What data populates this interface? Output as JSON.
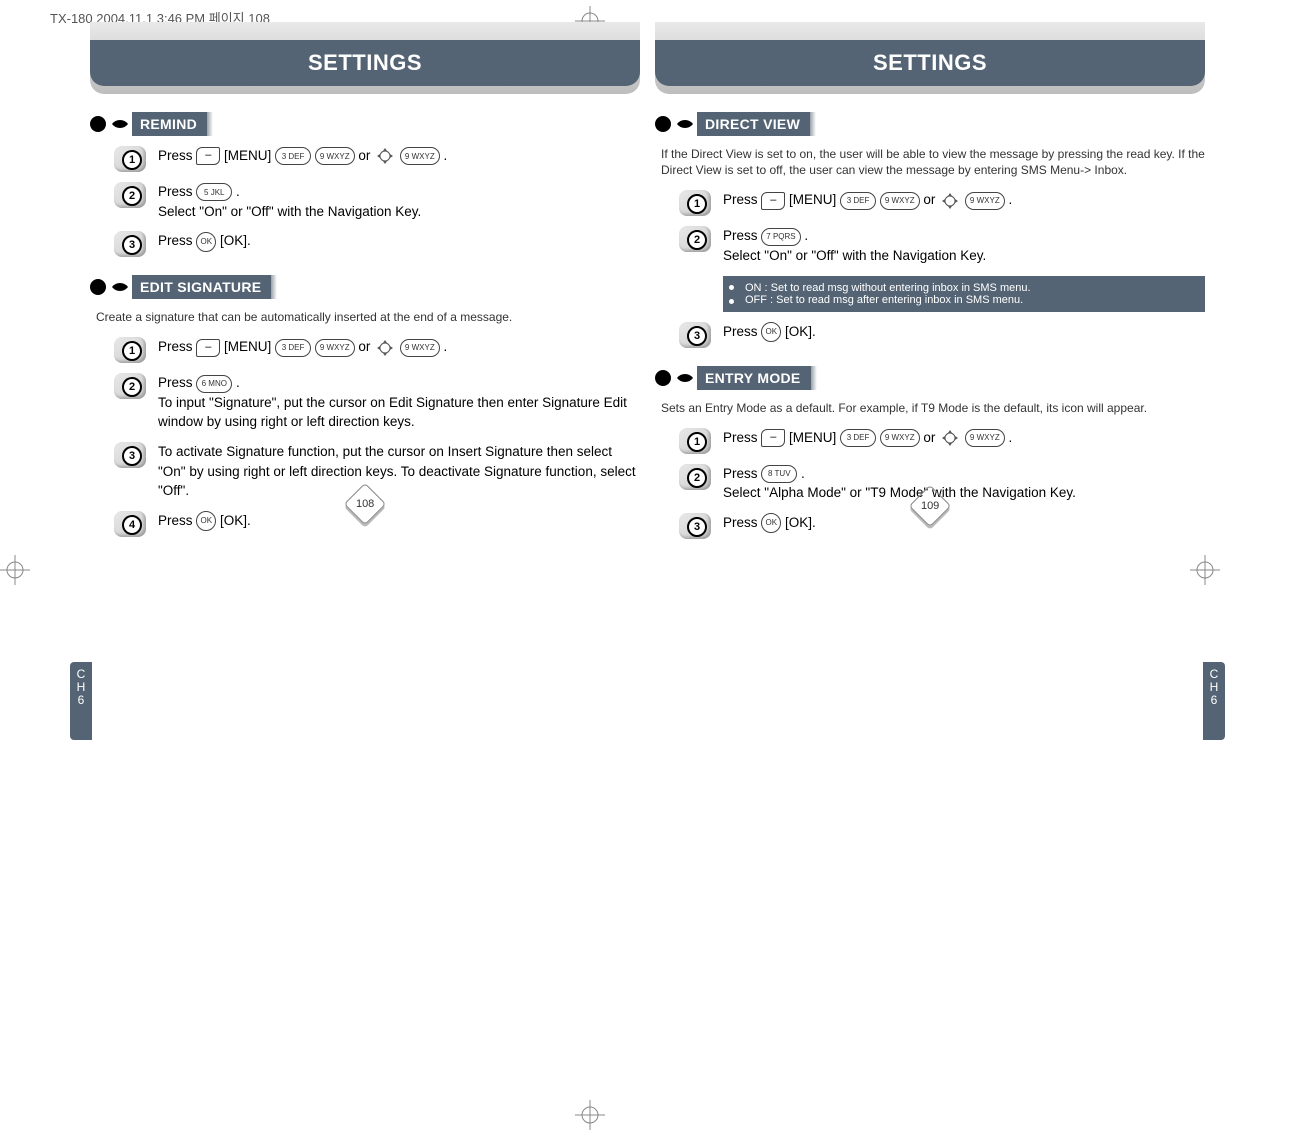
{
  "meta": {
    "doc_header": "TX-180  2004.11.1 3:46 PM  페이지 108"
  },
  "banner_title": "SETTINGS",
  "chapter_tab": {
    "line1": "C",
    "line2": "H",
    "num": "6"
  },
  "pages": {
    "left_num": "108",
    "right_num": "109"
  },
  "keys": {
    "menu": "[MENU]",
    "ok": "[OK]",
    "or": "or",
    "k3": "3 DEF",
    "k5": "5 JKL",
    "k6": "6 MNO",
    "k7": "7 PQRS",
    "k8": "8 TUV",
    "k9": "9 WXYZ",
    "okKey": "OK",
    "soft": "–"
  },
  "left": {
    "remind": {
      "title": "REMIND",
      "s1": "Press",
      "s1b": ".",
      "s2a": "Press",
      "s2b": ".",
      "s2c": "Select \"On\" or \"Off\" with the Navigation Key.",
      "s3a": "Press",
      "s3b": "[OK]."
    },
    "edit": {
      "title": "EDIT SIGNATURE",
      "intro": "Create a signature that can be automatically inserted at the end of a message.",
      "s1": "Press",
      "s1b": ".",
      "s2a": "Press",
      "s2b": ".",
      "s2c": "To input \"Signature\", put the cursor on Edit Signature then enter Signature Edit window by using right or left direction keys.",
      "s3": "To activate Signature function, put the cursor on Insert Signature then select \"On\" by using right or left direction keys. To deactivate Signature function, select \"Off\".",
      "s4a": "Press",
      "s4b": "[OK]."
    }
  },
  "right": {
    "direct": {
      "title": "DIRECT VIEW",
      "intro": "If the Direct View is set to on, the user will be able to view the message by pressing the read key. If the Direct View is set to off, the user can view the message by entering SMS Menu-> Inbox.",
      "s1": "Press",
      "s1b": ".",
      "s2a": "Press",
      "s2b": ".",
      "s2c": "Select \"On\" or \"Off\" with the Navigation Key.",
      "note1": "ON : Set to read msg without entering inbox in SMS menu.",
      "note2": "OFF : Set to read msg after entering inbox in SMS menu.",
      "s3a": "Press",
      "s3b": "[OK]."
    },
    "entry": {
      "title": "ENTRY MODE",
      "intro": "Sets an Entry Mode as a default. For example, if T9 Mode is the default, its icon will appear.",
      "s1": "Press",
      "s1b": ".",
      "s2a": "Press",
      "s2b": ".",
      "s2c": "Select  \"Alpha Mode\" or \"T9 Mode\" with the Navigation Key.",
      "s3a": "Press",
      "s3b": "[OK]."
    }
  }
}
